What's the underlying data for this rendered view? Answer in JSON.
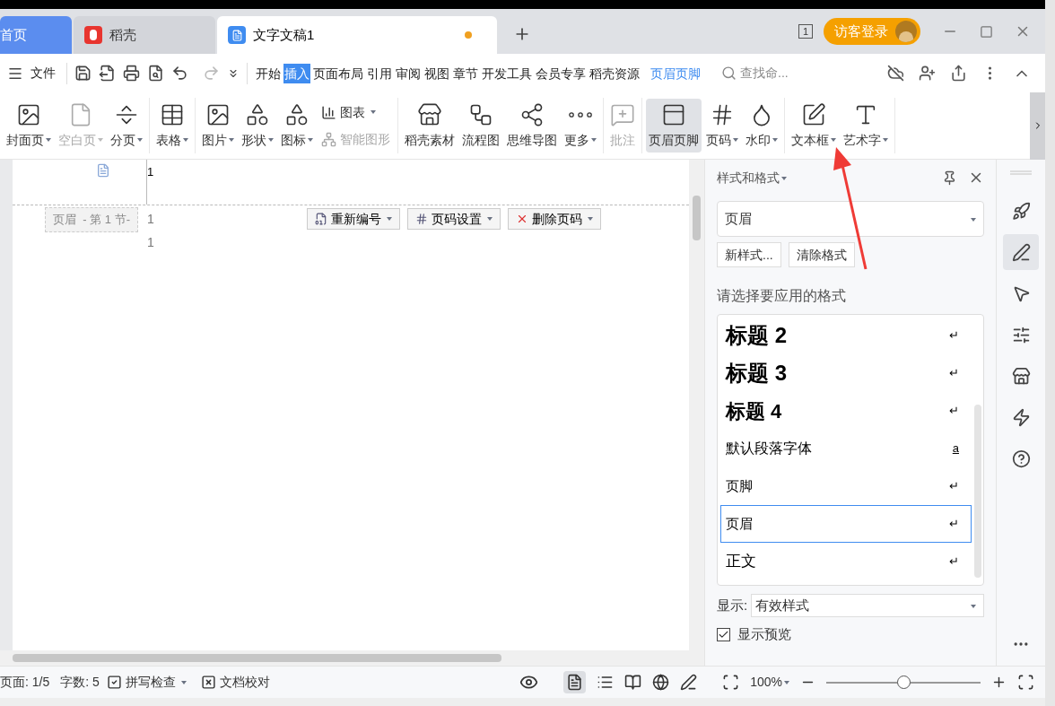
{
  "tabs": [
    {
      "label": "首页",
      "kind": "home",
      "selected": false
    },
    {
      "label": "稻壳",
      "kind": "docer",
      "selected": false
    },
    {
      "label": "文字文稿1",
      "kind": "doc",
      "selected": true,
      "modified": true
    }
  ],
  "title_bar": {
    "window_count": "1",
    "login_label": "访客登录"
  },
  "menu": {
    "file_label": "文件",
    "tabs": [
      {
        "label": "开始",
        "selected": false,
        "kind": "normal"
      },
      {
        "label": "插入",
        "selected": true,
        "kind": "normal"
      },
      {
        "label": "页面布局",
        "selected": false,
        "kind": "normal"
      },
      {
        "label": "引用",
        "selected": false,
        "kind": "normal"
      },
      {
        "label": "审阅",
        "selected": false,
        "kind": "normal"
      },
      {
        "label": "视图",
        "selected": false,
        "kind": "normal"
      },
      {
        "label": "章节",
        "selected": false,
        "kind": "normal"
      },
      {
        "label": "开发工具",
        "selected": false,
        "kind": "normal"
      },
      {
        "label": "会员专享",
        "selected": false,
        "kind": "normal"
      },
      {
        "label": "稻壳资源",
        "selected": false,
        "kind": "normal"
      },
      {
        "label": "页眉页脚",
        "selected": false,
        "kind": "contextual"
      }
    ],
    "search_placeholder": "查找命..."
  },
  "ribbon": {
    "groups": [
      {
        "items": [
          {
            "label": "封面页",
            "dropdown": true,
            "disabled": false,
            "selected": false,
            "kind": "large"
          },
          {
            "label": "空白页",
            "dropdown": true,
            "disabled": true,
            "selected": false,
            "kind": "large"
          },
          {
            "label": "分页",
            "dropdown": true,
            "disabled": false,
            "selected": false,
            "kind": "large"
          }
        ]
      },
      {
        "items": [
          {
            "label": "表格",
            "dropdown": true,
            "disabled": false,
            "selected": false,
            "kind": "large"
          }
        ]
      },
      {
        "items": [
          {
            "label": "图片",
            "dropdown": true,
            "disabled": false,
            "selected": false,
            "kind": "large"
          },
          {
            "label": "形状",
            "dropdown": true,
            "disabled": false,
            "selected": false,
            "kind": "large"
          },
          {
            "label": "图标",
            "dropdown": true,
            "disabled": false,
            "selected": false,
            "kind": "large"
          },
          {
            "label": "图表",
            "dropdown": true,
            "disabled": false,
            "selected": false,
            "kind": "small"
          },
          {
            "label": "智能图形",
            "dropdown": false,
            "disabled": true,
            "selected": false,
            "kind": "small"
          }
        ]
      },
      {
        "items": [
          {
            "label": "稻壳素材",
            "dropdown": false,
            "disabled": false,
            "selected": false,
            "kind": "large"
          },
          {
            "label": "流程图",
            "dropdown": false,
            "disabled": false,
            "selected": false,
            "kind": "large"
          },
          {
            "label": "思维导图",
            "dropdown": false,
            "disabled": false,
            "selected": false,
            "kind": "large"
          },
          {
            "label": "更多",
            "dropdown": true,
            "disabled": false,
            "selected": false,
            "kind": "large"
          }
        ]
      },
      {
        "items": [
          {
            "label": "批注",
            "dropdown": false,
            "disabled": true,
            "selected": false,
            "kind": "large"
          }
        ]
      },
      {
        "items": [
          {
            "label": "页眉页脚",
            "dropdown": false,
            "disabled": false,
            "selected": true,
            "kind": "large"
          },
          {
            "label": "页码",
            "dropdown": true,
            "disabled": false,
            "selected": false,
            "kind": "large"
          },
          {
            "label": "水印",
            "dropdown": true,
            "disabled": false,
            "selected": false,
            "kind": "large"
          }
        ]
      },
      {
        "items": [
          {
            "label": "文本框",
            "dropdown": true,
            "disabled": false,
            "selected": false,
            "kind": "large"
          },
          {
            "label": "艺术字",
            "dropdown": true,
            "disabled": false,
            "selected": false,
            "kind": "large"
          }
        ]
      }
    ]
  },
  "document": {
    "top_line_number": "1",
    "header_label": "页眉  - 第 1 节-",
    "header_line_numbers": [
      "1",
      "1"
    ],
    "header_buttons": [
      "重新编号",
      "页码设置",
      "删除页码"
    ]
  },
  "styles_panel": {
    "title": "样式和格式",
    "current_style": "页眉",
    "buttons": [
      "新样式...",
      "清除格式"
    ],
    "prompt": "请选择要应用的格式",
    "styles": [
      {
        "name": "标题  2",
        "kind": "heading2",
        "mark": "↵",
        "selected": false
      },
      {
        "name": "标题  3",
        "kind": "heading3",
        "mark": "↵",
        "selected": false
      },
      {
        "name": "标题  4",
        "kind": "heading4",
        "mark": "↵",
        "selected": false
      },
      {
        "name": "默认段落字体",
        "kind": "character",
        "mark": "a",
        "selected": false
      },
      {
        "name": "页脚",
        "kind": "paragraph",
        "mark": "↵",
        "selected": false
      },
      {
        "name": "页眉",
        "kind": "paragraph",
        "mark": "↵",
        "selected": true
      },
      {
        "name": "正文",
        "kind": "body",
        "mark": "↵",
        "selected": false
      }
    ],
    "show_label": "显示:",
    "show_value": "有效样式",
    "preview_label": "显示预览",
    "preview_checked": true
  },
  "status_bar": {
    "page": "页面: 1/5",
    "words": "字数: 5",
    "spell_check": "拼写检查",
    "proofread": "文档校对",
    "zoom": "100%",
    "zoom_slider": {
      "level": 0.5
    }
  }
}
